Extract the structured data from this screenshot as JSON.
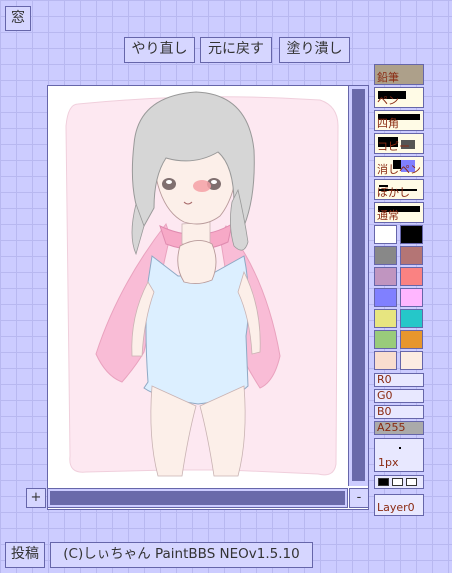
{
  "toolbar": {
    "window_label": "窓",
    "redo_label": "やり直し",
    "undo_label": "元に戻す",
    "fill_label": "塗り潰し"
  },
  "tools": [
    {
      "name": "pencil",
      "label": "鉛筆",
      "selected": true
    },
    {
      "name": "pen",
      "label": "ペン",
      "selected": false
    },
    {
      "name": "rectangle",
      "label": "四角",
      "selected": false
    },
    {
      "name": "copy",
      "label": "コピー",
      "selected": false
    },
    {
      "name": "eraser",
      "label": "消しペン",
      "selected": false
    },
    {
      "name": "blur",
      "label": "ぼかし",
      "selected": false
    },
    {
      "name": "hand",
      "label": "通常",
      "selected": false
    }
  ],
  "palette": [
    "#ffffff",
    "#000000",
    "#888888",
    "#b47575",
    "#c095c0",
    "#fa8282",
    "#8080ff",
    "#ffb6ff",
    "#e7e580",
    "#25c7c9",
    "#99cb7b",
    "#e7962d",
    "#f9ddcf",
    "#fcece2"
  ],
  "sliders": {
    "r_label": "R0",
    "g_label": "G0",
    "b_label": "B0",
    "a_label": "A255"
  },
  "brush": {
    "size_label": "1px"
  },
  "layer": {
    "label": "Layer0"
  },
  "zoom": {
    "in_label": "+",
    "out_label": "-"
  },
  "footer": {
    "post_label": "投稿",
    "credit": "(C)しぃちゃん PaintBBS NEOv1.5.10"
  }
}
